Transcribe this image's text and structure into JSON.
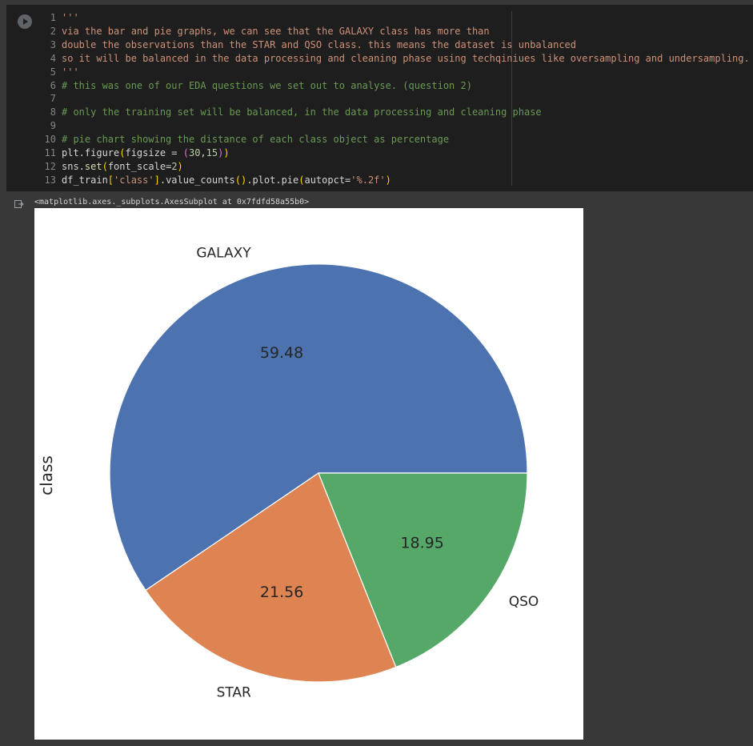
{
  "code": {
    "lines": [
      {
        "n": "1",
        "parts": [
          {
            "t": "'''",
            "c": "c-str"
          }
        ]
      },
      {
        "n": "2",
        "parts": [
          {
            "t": "via the bar and pie graphs, we can see that the GALAXY class has more than",
            "c": "c-str"
          }
        ]
      },
      {
        "n": "3",
        "parts": [
          {
            "t": "double the observations than the STAR and QSO class. this means the dataset is unbalanced",
            "c": "c-str"
          }
        ]
      },
      {
        "n": "4",
        "parts": [
          {
            "t": "so it will be balanced in the data processing and cleaning phase using techqiniues like oversampling and undersampling.",
            "c": "c-str"
          }
        ]
      },
      {
        "n": "5",
        "parts": [
          {
            "t": "'''",
            "c": "c-str"
          }
        ]
      },
      {
        "n": "6",
        "parts": [
          {
            "t": "# this was one of our EDA questions we set out to analyse. (question 2)",
            "c": "c-com"
          }
        ]
      },
      {
        "n": "7",
        "parts": []
      },
      {
        "n": "8",
        "parts": [
          {
            "t": "# only the training set will be balanced, in the data processing and cleaning phase",
            "c": "c-com"
          }
        ]
      },
      {
        "n": "9",
        "parts": []
      },
      {
        "n": "10",
        "parts": [
          {
            "t": "# pie chart showing the distance of each class object as percentage",
            "c": "c-com"
          }
        ]
      },
      {
        "n": "11",
        "parts": [
          {
            "t": "plt.figure",
            "c": "c-def"
          },
          {
            "t": "(",
            "c": "c-br"
          },
          {
            "t": "figsize = ",
            "c": "c-def"
          },
          {
            "t": "(",
            "c": "c-br2"
          },
          {
            "t": "30",
            "c": "c-num"
          },
          {
            "t": ",",
            "c": "c-def"
          },
          {
            "t": "15",
            "c": "c-num"
          },
          {
            "t": ")",
            "c": "c-br2"
          },
          {
            "t": ")",
            "c": "c-br"
          }
        ]
      },
      {
        "n": "12",
        "parts": [
          {
            "t": "sns.",
            "c": "c-def"
          },
          {
            "t": "set",
            "c": "c-fn"
          },
          {
            "t": "(",
            "c": "c-br"
          },
          {
            "t": "font_scale=",
            "c": "c-def"
          },
          {
            "t": "2",
            "c": "c-num"
          },
          {
            "t": ")",
            "c": "c-br"
          }
        ]
      },
      {
        "n": "13",
        "parts": [
          {
            "t": "df_train",
            "c": "c-def"
          },
          {
            "t": "[",
            "c": "c-br"
          },
          {
            "t": "'class'",
            "c": "c-str"
          },
          {
            "t": "]",
            "c": "c-br"
          },
          {
            "t": ".value_counts",
            "c": "c-def"
          },
          {
            "t": "()",
            "c": "c-br"
          },
          {
            "t": ".plot.pie",
            "c": "c-def"
          },
          {
            "t": "(",
            "c": "c-br"
          },
          {
            "t": "autopct=",
            "c": "c-def"
          },
          {
            "t": "'%.2f'",
            "c": "c-str"
          },
          {
            "t": ")",
            "c": "c-br"
          }
        ]
      }
    ]
  },
  "output": {
    "repr_text": "<matplotlib.axes._subplots.AxesSubplot at 0x7fdfd58a55b0>"
  },
  "chart_data": {
    "type": "pie",
    "ylabel": "class",
    "labels": [
      "GALAXY",
      "STAR",
      "QSO"
    ],
    "values": [
      59.48,
      21.56,
      18.95
    ],
    "pct_labels": [
      "59.48",
      "21.56",
      "18.95"
    ],
    "colors": [
      "#4c72b0",
      "#dd8452",
      "#55a868"
    ]
  }
}
